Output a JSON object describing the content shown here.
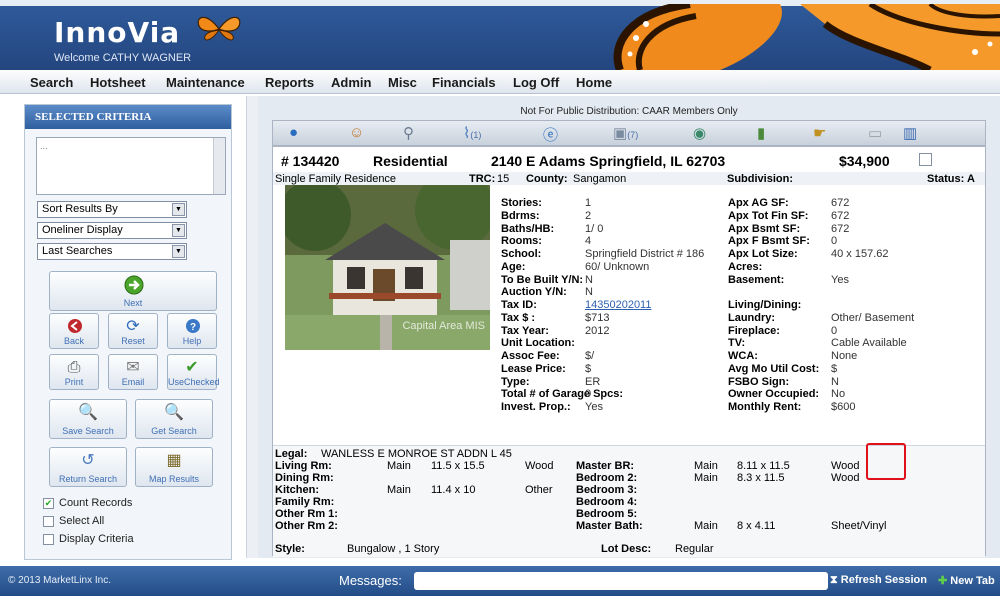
{
  "app": {
    "logo": "InnoVia",
    "welcome": "Welcome CATHY WAGNER"
  },
  "nav": [
    "Search",
    "Hotsheet",
    "Maintenance",
    "Reports",
    "Admin",
    "Misc",
    "Financials",
    "Log Off",
    "Home"
  ],
  "sidebar": {
    "title": "SELECTED CRITERIA",
    "criteria_text": "...",
    "selects": [
      "Sort Results By",
      "Oneliner Display",
      "Last Searches"
    ],
    "buttons": {
      "next": "Next",
      "back": "Back",
      "reset": "Reset",
      "help": "Help",
      "print": "Print",
      "email": "Email",
      "use_checked": "UseChecked",
      "save_search": "Save Search",
      "get_search": "Get Search",
      "return_search": "Return Search",
      "map_results": "Map Results"
    },
    "checkboxes": [
      {
        "label": "Count Records",
        "checked": true
      },
      {
        "label": "Select All",
        "checked": false
      },
      {
        "label": "Display Criteria",
        "checked": false
      }
    ]
  },
  "notice": "Not For Public Distribution: CAAR Members Only",
  "icons": {
    "photos_count": "(1)",
    "docs_count": "(7)"
  },
  "listing": {
    "mls": "# 134420",
    "category": "Residential",
    "address": "2140 E Adams  Springfield, IL  62703",
    "price": "$34,900",
    "type": "Single Family Residence",
    "trc_label": "TRC:",
    "trc": "15",
    "county_label": "County:",
    "county": "Sangamon",
    "subdivision_label": "Subdivision:",
    "status_label": "Status:",
    "status": "A",
    "watermark": "Capital Area MIS",
    "details_left": [
      {
        "label": "Stories:",
        "value": "1"
      },
      {
        "label": "Bdrms:",
        "value": "2"
      },
      {
        "label": "Baths/HB:",
        "value": "1/ 0"
      },
      {
        "label": "Rooms:",
        "value": "4"
      },
      {
        "label": "School:",
        "value": "Springfield District # 186"
      },
      {
        "label": "Age:",
        "value": "60/ Unknown"
      },
      {
        "label": "To Be Built Y/N:",
        "value": "N"
      },
      {
        "label": "Auction Y/N:",
        "value": "N"
      },
      {
        "label": "Tax ID:",
        "value": "14350202011"
      },
      {
        "label": "Tax $ :",
        "value": "$713"
      },
      {
        "label": "Tax Year:",
        "value": "2012"
      },
      {
        "label": "Unit Location:",
        "value": ""
      },
      {
        "label": "Assoc Fee:",
        "value": "$/"
      },
      {
        "label": "Lease Price:",
        "value": "$"
      },
      {
        "label": "Type:",
        "value": "ER"
      },
      {
        "label": "Total # of Garage Spcs:",
        "value": "0"
      },
      {
        "label": "Invest. Prop.:",
        "value": "Yes"
      }
    ],
    "details_right": [
      {
        "label": "Apx AG SF:",
        "value": "672"
      },
      {
        "label": "Apx Tot Fin SF:",
        "value": "672"
      },
      {
        "label": "Apx Bsmt SF:",
        "value": "672"
      },
      {
        "label": "Apx F Bsmt SF:",
        "value": "0"
      },
      {
        "label": "Apx Lot Size:",
        "value": "40 x 157.62"
      },
      {
        "label": "Acres:",
        "value": ""
      },
      {
        "label": "Basement:",
        "value": "Yes"
      },
      {
        "label": "",
        "value": ""
      },
      {
        "label": "Living/Dining:",
        "value": ""
      },
      {
        "label": "Laundry:",
        "value": "Other/ Basement"
      },
      {
        "label": "Fireplace:",
        "value": "0"
      },
      {
        "label": "TV:",
        "value": "Cable Available"
      },
      {
        "label": "WCA:",
        "value": "None"
      },
      {
        "label": "Avg Mo Util Cost:",
        "value": "$"
      },
      {
        "label": "FSBO Sign:",
        "value": "N"
      },
      {
        "label": "Owner Occupied:",
        "value": "No"
      },
      {
        "label": "Monthly Rent:",
        "value": "$600"
      }
    ],
    "legal_label": "Legal:",
    "legal": "WANLESS E MONROE ST ADDN L 45",
    "rooms_left": [
      {
        "label": "Living Rm:",
        "level": "Main",
        "size": "11.5 x 15.5",
        "floor": "Wood"
      },
      {
        "label": "Dining Rm:",
        "level": "",
        "size": "",
        "floor": ""
      },
      {
        "label": "Kitchen:",
        "level": "Main",
        "size": "11.4 x 10",
        "floor": "Other"
      },
      {
        "label": "Family Rm:",
        "level": "",
        "size": "",
        "floor": ""
      },
      {
        "label": "Other Rm 1:",
        "level": "",
        "size": "",
        "floor": ""
      },
      {
        "label": "Other Rm 2:",
        "level": "",
        "size": "",
        "floor": ""
      }
    ],
    "rooms_right": [
      {
        "label": "Master BR:",
        "level": "Main",
        "size": "8.11 x 11.5",
        "floor": "Wood"
      },
      {
        "label": "Bedroom 2:",
        "level": "Main",
        "size": "8.3 x 11.5",
        "floor": "Wood"
      },
      {
        "label": "Bedroom 3:",
        "level": "",
        "size": "",
        "floor": ""
      },
      {
        "label": "Bedroom 4:",
        "level": "",
        "size": "",
        "floor": ""
      },
      {
        "label": "Bedroom 5:",
        "level": "",
        "size": "",
        "floor": ""
      },
      {
        "label": "Master Bath:",
        "level": "Main",
        "size": "8 x 4.11",
        "floor": "Sheet/Vinyl"
      }
    ],
    "style_label": "Style:",
    "style": "Bungalow , 1 Story",
    "lotdesc_label": "Lot Desc:",
    "lotdesc": "Regular"
  },
  "footer": {
    "copyright": "© 2013 MarketLinx Inc.",
    "messages_label": "Messages:",
    "refresh": "Refresh Session",
    "new_tab": "New Tab"
  }
}
